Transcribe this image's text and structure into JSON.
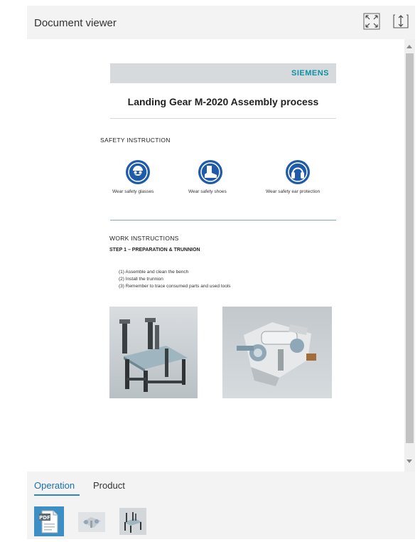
{
  "header": {
    "title": "Document viewer"
  },
  "document": {
    "brand": "SIEMENS",
    "title": "Landing Gear M-2020 Assembly process",
    "safety_heading": "SAFETY INSTRUCTION",
    "safety_items": [
      "Wear safety glasses",
      "Wear safety shoes",
      "Wear safety ear protection"
    ],
    "work_heading": "WORK INSTRUCTIONS",
    "step_heading": "STEP 1 – PREPARATION & TRUNNION",
    "instructions": [
      "(1) Assemble and clean the bench",
      "(2) Install the trunnion",
      "(3) Remember to trace consumed parts and used tools"
    ]
  },
  "bottom": {
    "tabs": [
      "Operation",
      "Product"
    ],
    "active_tab": "Operation",
    "thumbnails": [
      "pdf-document",
      "part-model",
      "fixture-model"
    ]
  },
  "colors": {
    "accent": "#2d84c4",
    "brand": "#0f8fa3",
    "safety_blue": "#1f5ba8"
  }
}
